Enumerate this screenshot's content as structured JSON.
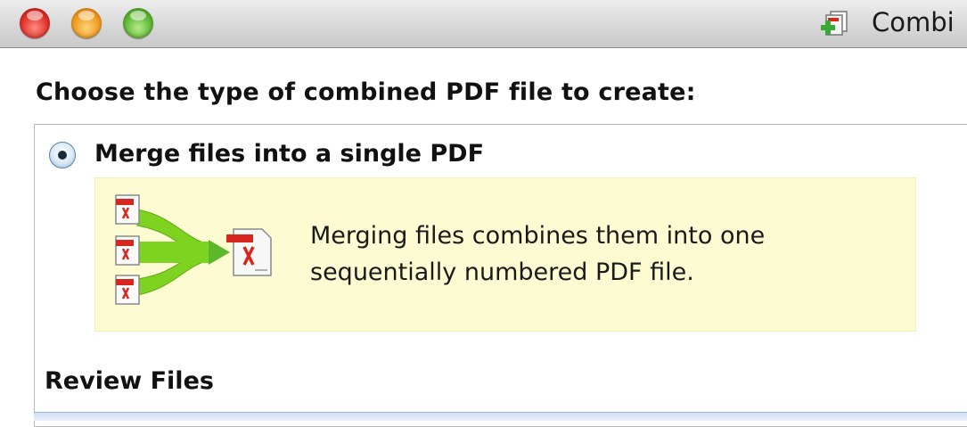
{
  "window": {
    "title": "Combi",
    "title_icon": "combine-files-icon",
    "controls": [
      "close",
      "minimize",
      "zoom"
    ]
  },
  "main": {
    "heading": "Choose the type of combined PDF file to create:",
    "options": [
      {
        "label": "Merge files into a single PDF",
        "selected": true,
        "description_lines": [
          "Merging files combines them into one",
          "sequentially numbered PDF file."
        ],
        "icon": "merge-pdf-illustration"
      }
    ],
    "section_heading": "Review Files"
  },
  "colors": {
    "info_background": "#fdfbd2",
    "merge_arrow": "#7ed321",
    "pdf_red": "#d7261e"
  }
}
